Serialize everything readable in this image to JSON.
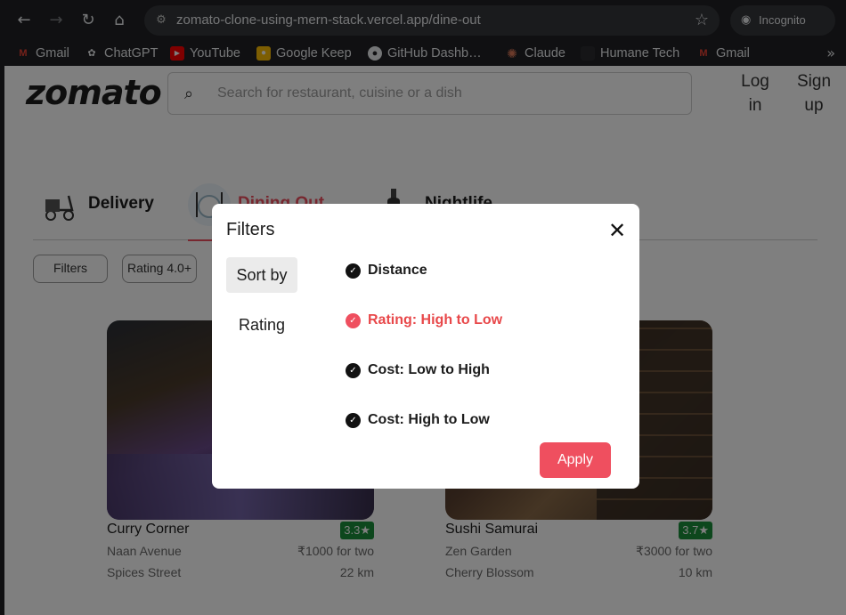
{
  "browser": {
    "url": "zomato-clone-using-mern-stack.vercel.app/dine-out",
    "incognito_label": "Incognito",
    "bookmarks": [
      {
        "label": "Gmail",
        "icon": "gmail-icon",
        "color": "#ea4335"
      },
      {
        "label": "ChatGPT",
        "icon": "chatgpt-icon",
        "color": "#e8eaed"
      },
      {
        "label": "YouTube",
        "icon": "youtube-icon",
        "color": "#ff0000"
      },
      {
        "label": "Google Keep",
        "icon": "keep-icon",
        "color": "#fbbc04"
      },
      {
        "label": "GitHub Dashb…",
        "icon": "github-icon",
        "color": "#e8eaed"
      },
      {
        "label": "Claude",
        "icon": "claude-icon",
        "color": "#d97757"
      },
      {
        "label": "Humane Tech",
        "icon": "humane-icon",
        "color": "#3c4043"
      },
      {
        "label": "Gmail",
        "icon": "gmail-icon",
        "color": "#ea4335"
      }
    ]
  },
  "header": {
    "logo": "zomato",
    "search_placeholder": "Search for restaurant, cuisine or a dish",
    "login_line1": "Log",
    "login_line2": "in",
    "signup_line1": "Sign",
    "signup_line2": "up"
  },
  "tabs": [
    {
      "label": "Delivery",
      "icon": "scooter-icon"
    },
    {
      "label": "Dining Out",
      "icon": "dining-icon",
      "active": true
    },
    {
      "label": "Nightlife",
      "icon": "bottle-icon"
    }
  ],
  "chips": [
    "Filters",
    "Rating 4.0+"
  ],
  "restaurants": [
    {
      "name": "Curry Corner",
      "rating": "3.3★",
      "area": "Naan Avenue",
      "cost": "₹1000 for two",
      "street": "Spices Street",
      "distance": "22 km"
    },
    {
      "name": "Sushi Samurai",
      "rating": "3.7★",
      "area": "Zen Garden",
      "cost": "₹3000 for two",
      "street": "Cherry Blossom",
      "distance": "10 km"
    }
  ],
  "modal": {
    "title": "Filters",
    "sidebar": [
      "Sort by",
      "Rating"
    ],
    "options": [
      "Distance",
      "Rating: High to Low",
      "Cost: Low to High",
      "Cost: High to Low"
    ],
    "selected_option": "Rating: High to Low",
    "apply_label": "Apply"
  },
  "colors": {
    "brand": "#ef4f5f",
    "rating_green": "#1a8f3a"
  }
}
